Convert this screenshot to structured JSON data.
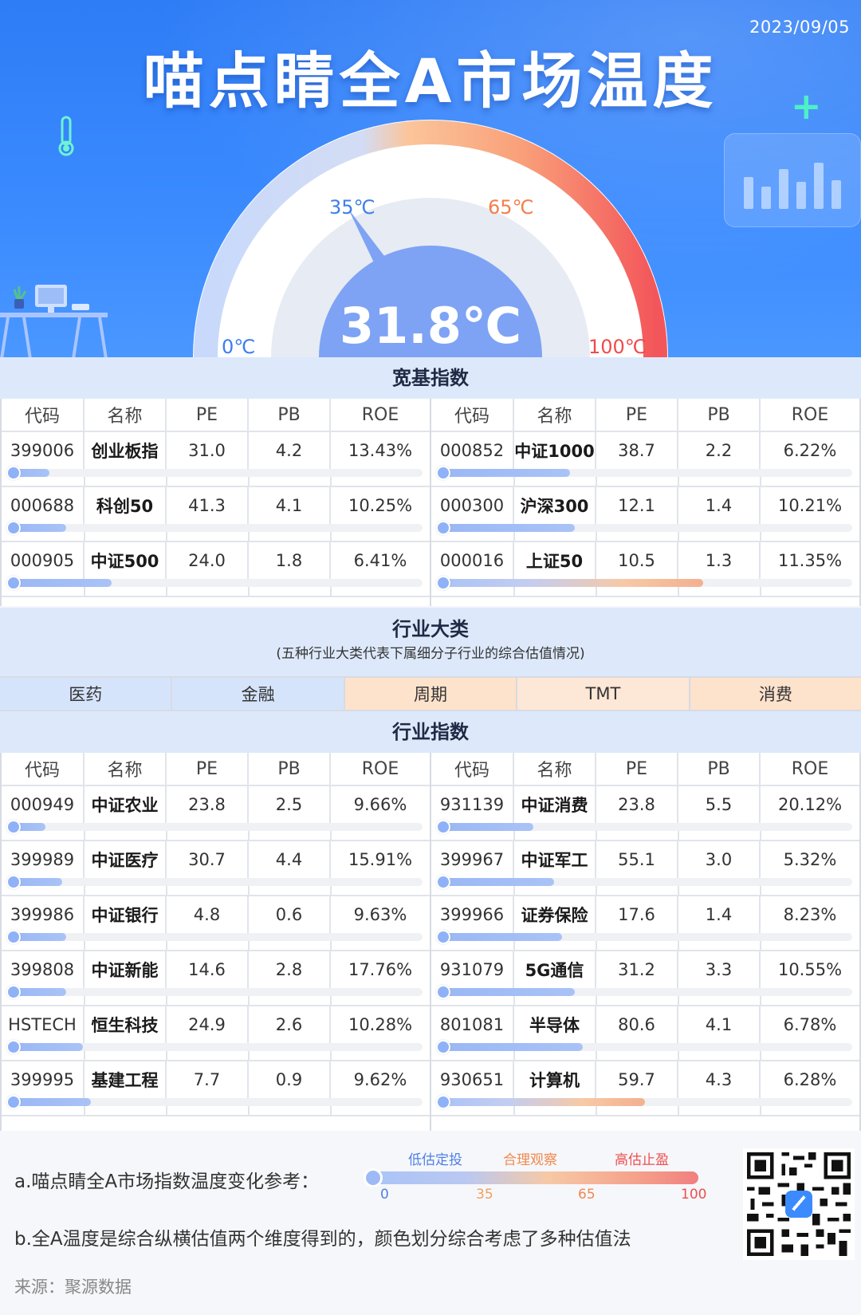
{
  "header": {
    "date": "2023/09/05",
    "title": "喵点睛全A市场温度",
    "temperature": "31.8℃",
    "temperature_value": 31.8,
    "ticks": {
      "t0": "0℃",
      "t35": "35℃",
      "t65": "65℃",
      "t100": "100℃"
    }
  },
  "broad": {
    "title": "宽基指数",
    "columns": [
      "代码",
      "名称",
      "PE",
      "PB",
      "ROE"
    ],
    "left": [
      {
        "code": "399006",
        "name": "创业板指",
        "pe": "31.0",
        "pb": "4.2",
        "roe": "13.43%",
        "level": 0.1,
        "color": "blue"
      },
      {
        "code": "000688",
        "name": "科创50",
        "pe": "41.3",
        "pb": "4.1",
        "roe": "10.25%",
        "level": 0.14,
        "color": "blue"
      },
      {
        "code": "000905",
        "name": "中证500",
        "pe": "24.0",
        "pb": "1.8",
        "roe": "6.41%",
        "level": 0.25,
        "color": "blue"
      }
    ],
    "right": [
      {
        "code": "000852",
        "name": "中证1000",
        "pe": "38.7",
        "pb": "2.2",
        "roe": "6.22%",
        "level": 0.32,
        "color": "blue"
      },
      {
        "code": "000300",
        "name": "沪深300",
        "pe": "12.1",
        "pb": "1.4",
        "roe": "10.21%",
        "level": 0.33,
        "color": "blue"
      },
      {
        "code": "000016",
        "name": "上证50",
        "pe": "10.5",
        "pb": "1.3",
        "roe": "11.35%",
        "level": 0.64,
        "color": "orange"
      }
    ]
  },
  "categories": {
    "title": "行业大类",
    "subtitle": "(五种行业大类代表下属细分子行业的综合估值情况)",
    "items": [
      {
        "label": "医药",
        "color": "#d6e4fb"
      },
      {
        "label": "金融",
        "color": "#d6e4fb"
      },
      {
        "label": "周期",
        "color": "#fde2cc"
      },
      {
        "label": "TMT",
        "color": "#fde7d6"
      },
      {
        "label": "消费",
        "color": "#fde2cc"
      }
    ]
  },
  "industry": {
    "title": "行业指数",
    "columns": [
      "代码",
      "名称",
      "PE",
      "PB",
      "ROE"
    ],
    "left": [
      {
        "code": "000949",
        "name": "中证农业",
        "pe": "23.8",
        "pb": "2.5",
        "roe": "9.66%",
        "level": 0.09,
        "color": "blue"
      },
      {
        "code": "399989",
        "name": "中证医疗",
        "pe": "30.7",
        "pb": "4.4",
        "roe": "15.91%",
        "level": 0.13,
        "color": "blue"
      },
      {
        "code": "399986",
        "name": "中证银行",
        "pe": "4.8",
        "pb": "0.6",
        "roe": "9.63%",
        "level": 0.14,
        "color": "blue"
      },
      {
        "code": "399808",
        "name": "中证新能",
        "pe": "14.6",
        "pb": "2.8",
        "roe": "17.76%",
        "level": 0.14,
        "color": "blue"
      },
      {
        "code": "HSTECH",
        "name": "恒生科技",
        "pe": "24.9",
        "pb": "2.6",
        "roe": "10.28%",
        "level": 0.18,
        "color": "blue"
      },
      {
        "code": "399995",
        "name": "基建工程",
        "pe": "7.7",
        "pb": "0.9",
        "roe": "9.62%",
        "level": 0.2,
        "color": "blue"
      }
    ],
    "right": [
      {
        "code": "931139",
        "name": "中证消费",
        "pe": "23.8",
        "pb": "5.5",
        "roe": "20.12%",
        "level": 0.23,
        "color": "blue"
      },
      {
        "code": "399967",
        "name": "中证军工",
        "pe": "55.1",
        "pb": "3.0",
        "roe": "5.32%",
        "level": 0.28,
        "color": "blue"
      },
      {
        "code": "399966",
        "name": "证券保险",
        "pe": "17.6",
        "pb": "1.4",
        "roe": "8.23%",
        "level": 0.3,
        "color": "blue"
      },
      {
        "code": "931079",
        "name": "5G通信",
        "pe": "31.2",
        "pb": "3.3",
        "roe": "10.55%",
        "level": 0.33,
        "color": "blue"
      },
      {
        "code": "801081",
        "name": "半导体",
        "pe": "80.6",
        "pb": "4.1",
        "roe": "6.78%",
        "level": 0.35,
        "color": "blue"
      },
      {
        "code": "930651",
        "name": "计算机",
        "pe": "59.7",
        "pb": "4.3",
        "roe": "6.28%",
        "level": 0.5,
        "color": "orange"
      }
    ]
  },
  "footer": {
    "note_a": "a.喵点睛全A市场指数温度变化参考：",
    "note_b": "b.全A温度是综合纵横估值两个维度得到的，颜色划分综合考虑了多种估值法",
    "source": "来源：聚源数据",
    "legend": {
      "low": "低估定投",
      "mid": "合理观察",
      "high": "高估止盈",
      "v0": "0",
      "v35": "35",
      "v65": "65",
      "v100": "100"
    }
  }
}
